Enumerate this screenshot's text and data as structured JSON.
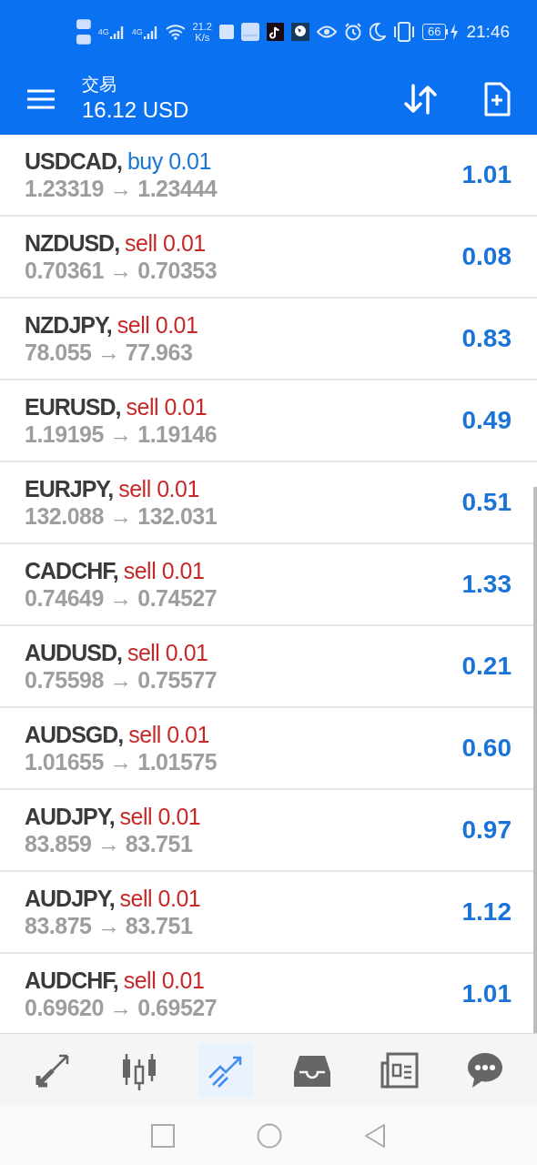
{
  "status_bar": {
    "network_4g": [
      "4G",
      "4G"
    ],
    "speed": "21.2",
    "speed_unit": "K/s",
    "battery": "66",
    "time": "21:46"
  },
  "header": {
    "title": "交易",
    "balance": "16.12 USD"
  },
  "positions": [
    {
      "symbol": "USDCAD,",
      "kind": "buy",
      "order": "buy 0.01",
      "prices": "1.23319 → 1.23444",
      "profit": "1.01"
    },
    {
      "symbol": "NZDUSD,",
      "kind": "sell",
      "order": "sell 0.01",
      "prices": "0.70361 → 0.70353",
      "profit": "0.08"
    },
    {
      "symbol": "NZDJPY,",
      "kind": "sell",
      "order": "sell 0.01",
      "prices": "78.055 → 77.963",
      "profit": "0.83"
    },
    {
      "symbol": "EURUSD,",
      "kind": "sell",
      "order": "sell 0.01",
      "prices": "1.19195 → 1.19146",
      "profit": "0.49"
    },
    {
      "symbol": "EURJPY,",
      "kind": "sell",
      "order": "sell 0.01",
      "prices": "132.088 → 132.031",
      "profit": "0.51"
    },
    {
      "symbol": "CADCHF,",
      "kind": "sell",
      "order": "sell 0.01",
      "prices": "0.74649 → 0.74527",
      "profit": "1.33"
    },
    {
      "symbol": "AUDUSD,",
      "kind": "sell",
      "order": "sell 0.01",
      "prices": "0.75598 → 0.75577",
      "profit": "0.21"
    },
    {
      "symbol": "AUDSGD,",
      "kind": "sell",
      "order": "sell 0.01",
      "prices": "1.01655 → 1.01575",
      "profit": "0.60"
    },
    {
      "symbol": "AUDJPY,",
      "kind": "sell",
      "order": "sell 0.01",
      "prices": "83.859 → 83.751",
      "profit": "0.97"
    },
    {
      "symbol": "AUDJPY,",
      "kind": "sell",
      "order": "sell 0.01",
      "prices": "83.875 → 83.751",
      "profit": "1.12"
    },
    {
      "symbol": "AUDCHF,",
      "kind": "sell",
      "order": "sell 0.01",
      "prices": "0.69620 → 0.69527",
      "profit": "1.01"
    }
  ],
  "bottom_tabs": [
    {
      "kind": "quotes",
      "selected": false
    },
    {
      "kind": "chart",
      "selected": false
    },
    {
      "kind": "trade",
      "selected": true
    },
    {
      "kind": "history",
      "selected": false
    },
    {
      "kind": "news",
      "selected": false
    },
    {
      "kind": "messages",
      "selected": false
    }
  ]
}
